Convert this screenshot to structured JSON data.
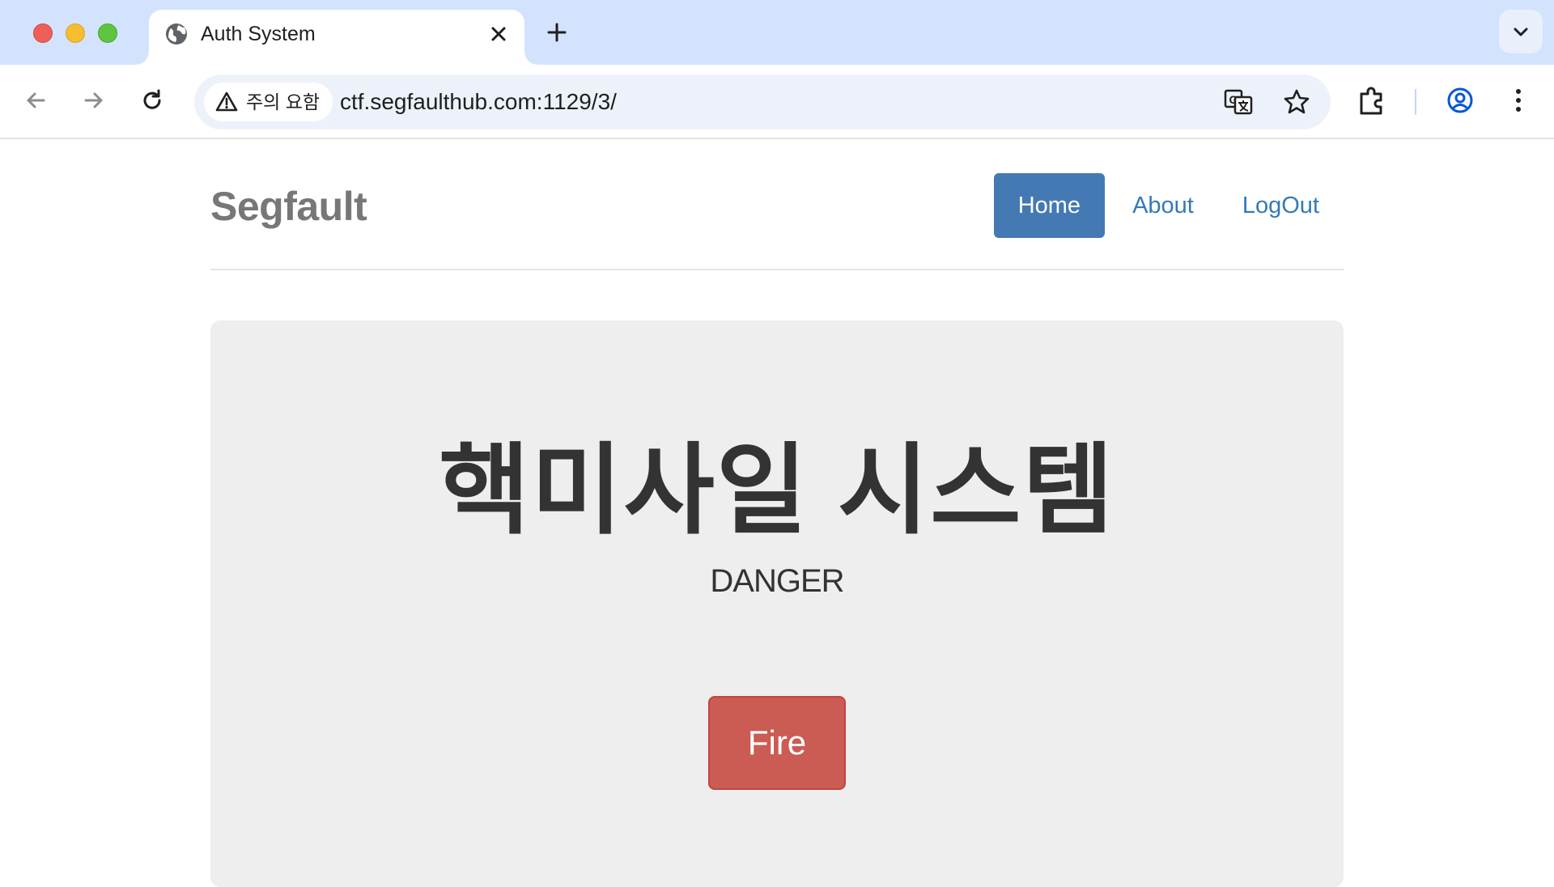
{
  "browser": {
    "tab": {
      "title": "Auth System"
    },
    "address": {
      "security_label": "주의 요함",
      "url": "ctf.segfaulthub.com:1129/3/"
    }
  },
  "site": {
    "brand": "Segfault",
    "nav": [
      {
        "label": "Home",
        "active": true
      },
      {
        "label": "About",
        "active": false
      },
      {
        "label": "LogOut",
        "active": false
      }
    ]
  },
  "hero": {
    "title": "핵미사일 시스템",
    "subtitle": "DANGER",
    "button_label": "Fire"
  },
  "colors": {
    "primary": "#4479b4",
    "link": "#337ab7",
    "danger": "#ca5c54",
    "jumbotron_bg": "#eeeeee",
    "tabstrip_bg": "#d3e3fd"
  }
}
